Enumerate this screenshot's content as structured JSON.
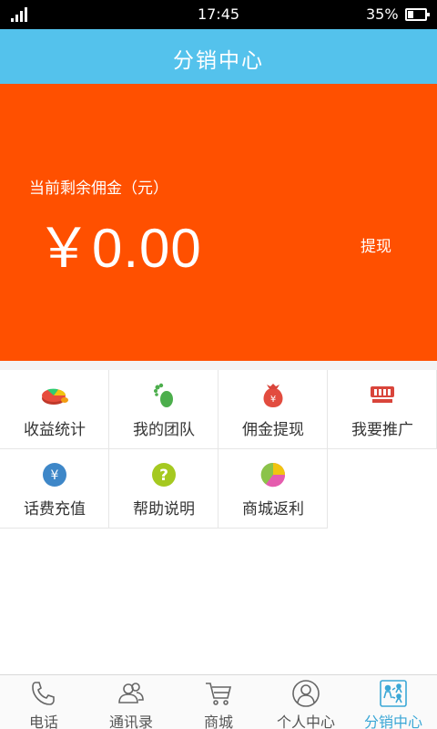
{
  "status_bar": {
    "time": "17:45",
    "battery": "35%",
    "battery_level": 0.35
  },
  "header": {
    "title": "分销中心"
  },
  "commission": {
    "label": "当前剩余佣金（元）",
    "amount": "￥0.00",
    "withdraw_label": "提现"
  },
  "colors": {
    "title_bar": "#54c2ec",
    "commission_panel": "#ff5000",
    "accent_active": "#3aa7d6"
  },
  "grid": [
    {
      "label": "收益统计",
      "icon": "pie-chart-icon"
    },
    {
      "label": "我的团队",
      "icon": "footprint-icon"
    },
    {
      "label": "佣金提现",
      "icon": "money-bag-icon"
    },
    {
      "label": "我要推广",
      "icon": "shop-awning-icon"
    },
    {
      "label": "话费充值",
      "icon": "yen-coin-icon"
    },
    {
      "label": "帮助说明",
      "icon": "question-icon"
    },
    {
      "label": "商城返利",
      "icon": "rebate-pie-icon"
    }
  ],
  "bottom_nav": [
    {
      "label": "电话",
      "icon": "phone-icon"
    },
    {
      "label": "通讯录",
      "icon": "contacts-icon"
    },
    {
      "label": "商城",
      "icon": "cart-icon"
    },
    {
      "label": "个人中心",
      "icon": "user-icon"
    },
    {
      "label": "分销中心",
      "icon": "distribution-icon",
      "active": true
    }
  ]
}
